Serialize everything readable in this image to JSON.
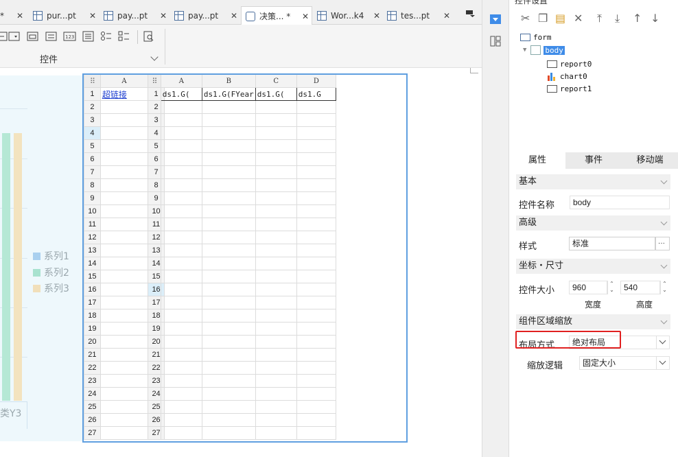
{
  "tabs": [
    {
      "label": "*",
      "close": "✕"
    },
    {
      "label": "pur...pt",
      "close": "✕"
    },
    {
      "label": "pay...pt",
      "close": "✕"
    },
    {
      "label": "pay...pt",
      "close": "✕"
    },
    {
      "label": "决策... *",
      "close": "✕"
    },
    {
      "label": "Wor...k4",
      "close": "✕"
    },
    {
      "label": "tes...pt",
      "close": "✕"
    }
  ],
  "toolbar": {
    "group_label": "控件"
  },
  "chart0": {
    "legend": [
      {
        "label": "系列1",
        "color": "#a9d0ef"
      },
      {
        "label": "系列2",
        "color": "#a8e2cf"
      },
      {
        "label": "系列3",
        "color": "#f1dfba"
      }
    ],
    "bar_colors": [
      "#b5e8d5",
      "#f3e3bf"
    ],
    "x_category": "类Y3"
  },
  "report0": {
    "col_header": "A",
    "link_text": "超链接",
    "rows": [
      "1",
      "2",
      "3",
      "4",
      "5",
      "6",
      "7",
      "8",
      "9",
      "10",
      "11",
      "12",
      "13",
      "14",
      "15",
      "16",
      "17",
      "18",
      "19",
      "20",
      "21",
      "22",
      "23",
      "24",
      "25",
      "26",
      "27"
    ]
  },
  "report1": {
    "col_headers": [
      "A",
      "B",
      "C",
      "D"
    ],
    "first_row_cells": [
      "ds1.G(",
      "ds1.G(FYear",
      "ds1.G(",
      "ds1.G"
    ],
    "rows": [
      "1",
      "2",
      "3",
      "4",
      "5",
      "6",
      "7",
      "8",
      "9",
      "10",
      "11",
      "12",
      "13",
      "14",
      "15",
      "16",
      "17",
      "18",
      "19",
      "20",
      "21",
      "22",
      "23",
      "24",
      "25",
      "26",
      "27"
    ]
  },
  "panel": {
    "title": "控件设置",
    "tree": {
      "form": "form",
      "body": "body",
      "children": [
        "report0",
        "chart0",
        "report1"
      ]
    },
    "tabs": [
      "属性",
      "事件",
      "移动端"
    ],
    "sections": {
      "basic": "基本",
      "advanced": "高级",
      "coords": "坐标・尺寸",
      "zoom": "组件区域缩放"
    },
    "props": {
      "name_label": "控件名称",
      "name_value": "body",
      "style_label": "样式",
      "style_value": "标准",
      "style_btn": "···",
      "size_label": "控件大小",
      "width_value": "960",
      "height_value": "540",
      "width_caption": "宽度",
      "height_caption": "高度",
      "layout_label": "布局方式",
      "layout_value": "绝对布局",
      "zoom_logic_label": "缩放逻辑",
      "zoom_logic_value": "固定大小"
    }
  },
  "colors": {
    "accent": "#3f8ce8",
    "highlight": "#e02020",
    "selection_outline": "#5f9fe0"
  }
}
